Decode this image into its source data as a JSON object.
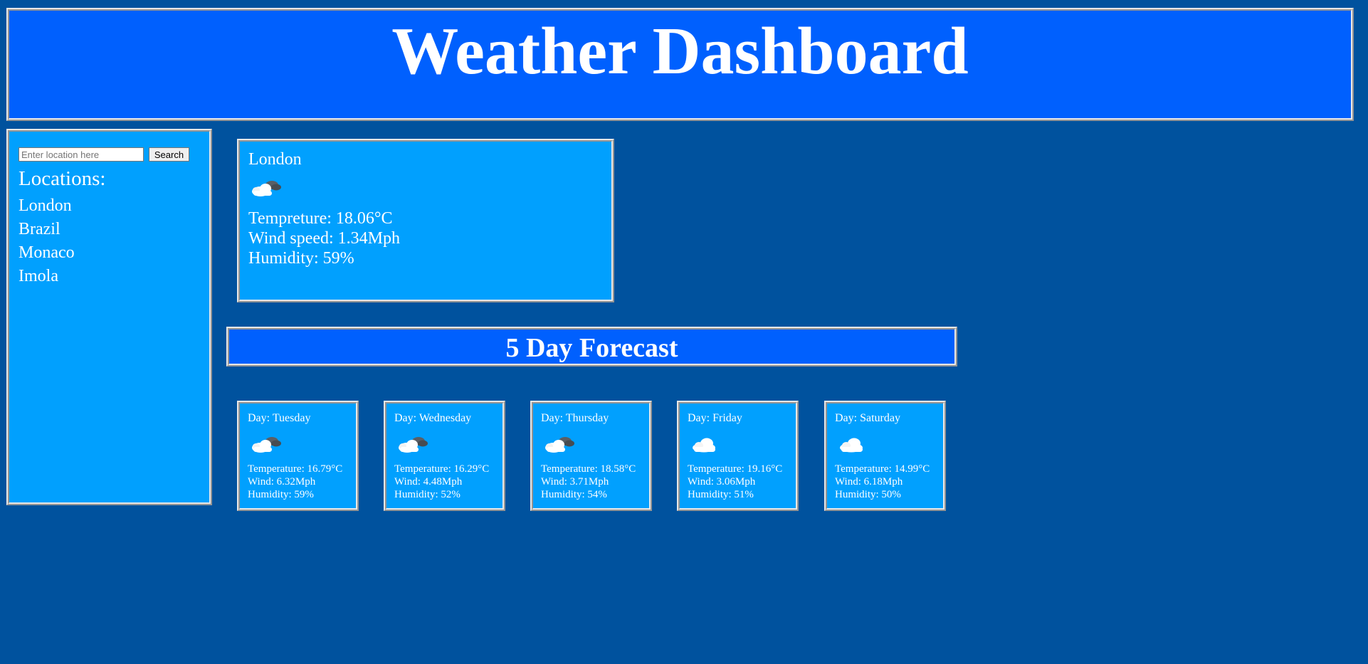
{
  "header": {
    "title": "Weather Dashboard"
  },
  "sidebar": {
    "search_placeholder": "Enter location here",
    "search_button_label": "Search",
    "locations_heading": "Locations:",
    "locations": [
      "London",
      "Brazil",
      "Monaco",
      "Imola"
    ]
  },
  "current": {
    "city": "London",
    "icon": "cloudy-icon",
    "temperature": "Tempreture: 18.06°C",
    "wind": "Wind speed: 1.34Mph",
    "humidity": "Humidity: 59%"
  },
  "forecast": {
    "title": "5 Day Forecast",
    "days": [
      {
        "day": "Day: Tuesday",
        "icon": "cloudy-icon",
        "temperature": "Temperature: 16.79°C",
        "wind": "Wind: 6.32Mph",
        "humidity": "Humidity: 59%"
      },
      {
        "day": "Day: Wednesday",
        "icon": "cloudy-icon",
        "temperature": "Temperature: 16.29°C",
        "wind": "Wind: 4.48Mph",
        "humidity": "Humidity: 52%"
      },
      {
        "day": "Day: Thursday",
        "icon": "cloudy-icon",
        "temperature": "Temperature: 18.58°C",
        "wind": "Wind: 3.71Mph",
        "humidity": "Humidity: 54%"
      },
      {
        "day": "Day: Friday",
        "icon": "cloud-icon",
        "temperature": "Temperature: 19.16°C",
        "wind": "Wind: 3.06Mph",
        "humidity": "Humidity: 51%"
      },
      {
        "day": "Day: Saturday",
        "icon": "cloud-icon",
        "temperature": "Temperature: 14.99°C",
        "wind": "Wind: 6.18Mph",
        "humidity": "Humidity: 50%"
      }
    ]
  },
  "colors": {
    "page_background": "#00529e",
    "header_blue": "#0060fe",
    "panel_cyan": "#01a0fe",
    "text": "#ffffff"
  }
}
